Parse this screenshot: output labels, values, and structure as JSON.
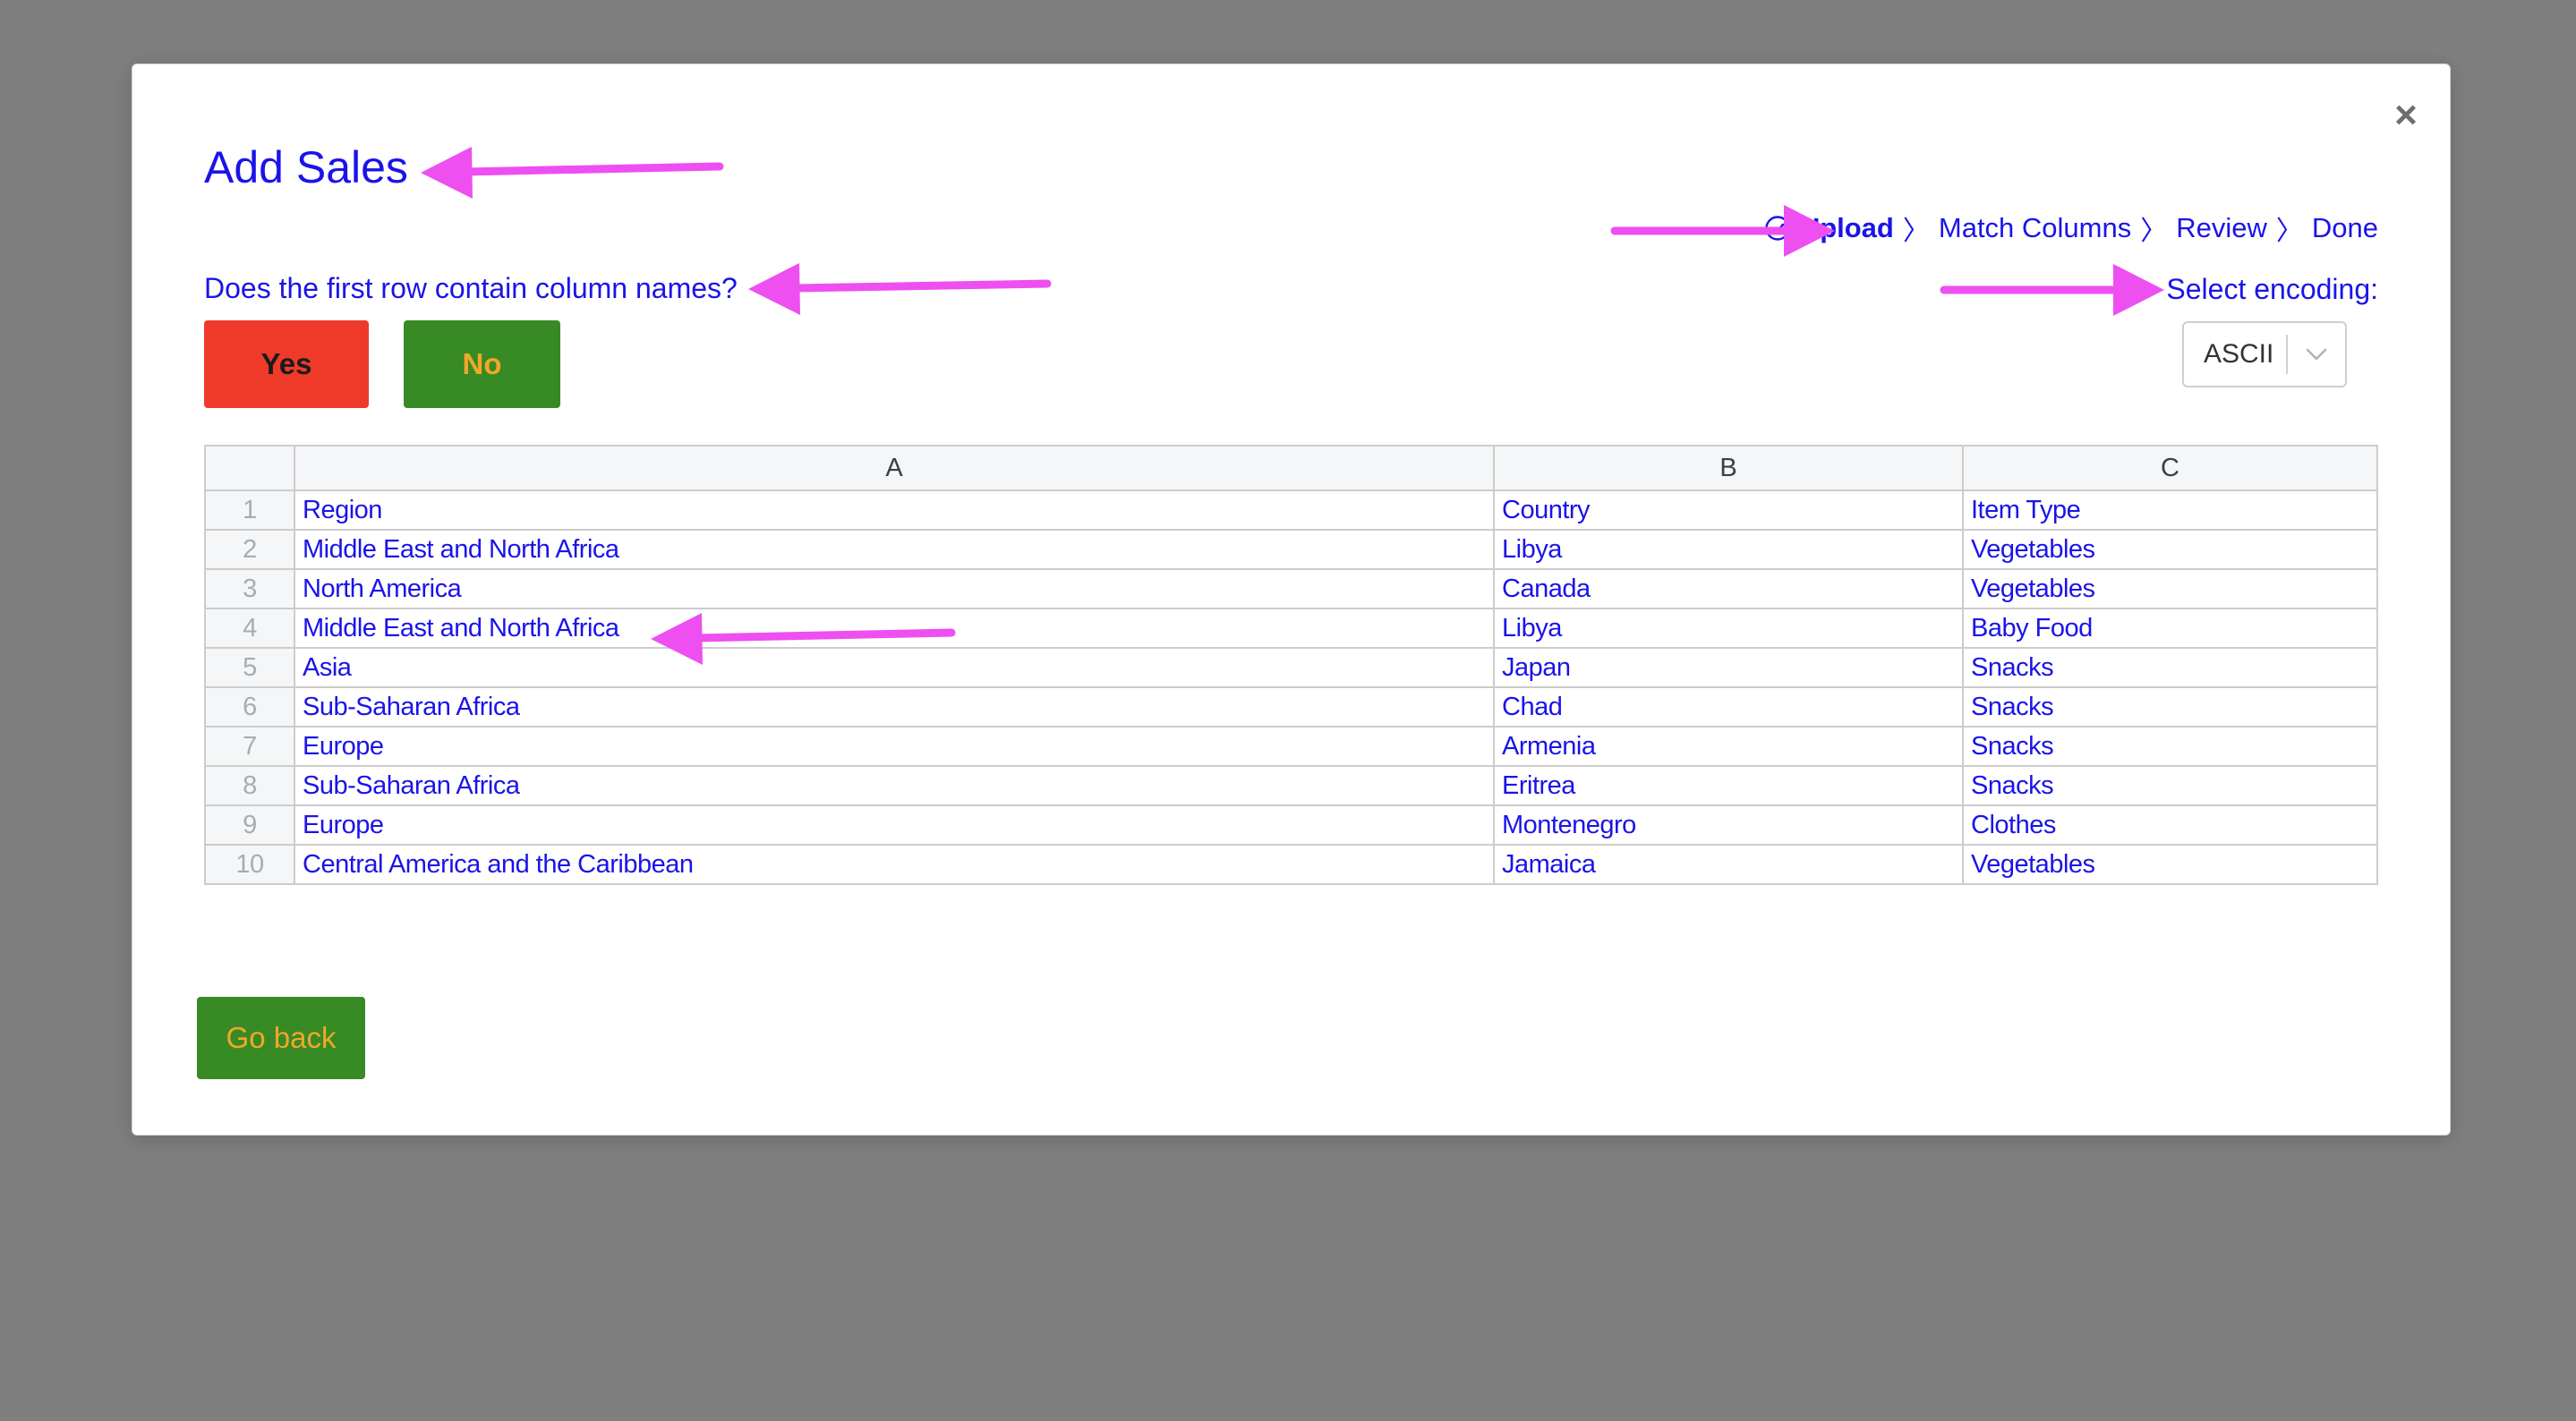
{
  "dialog": {
    "title": "Add Sales",
    "close_label": "×",
    "question": "Does the first row contain column names?",
    "yes_label": "Yes",
    "no_label": "No",
    "back_label": "Go back"
  },
  "steps": {
    "items": [
      "Upload",
      "Match Columns",
      "Review",
      "Done"
    ],
    "active": "Upload",
    "separator": "〉",
    "active_icon": "check-circle-icon"
  },
  "encoding": {
    "label": "Select encoding:",
    "value": "ASCII",
    "icon": "chevron-down-icon"
  },
  "table": {
    "columns": [
      "A",
      "B",
      "C"
    ],
    "rows": [
      {
        "n": "1",
        "a": "Region",
        "b": "Country",
        "c": "Item Type"
      },
      {
        "n": "2",
        "a": "Middle East and North Africa",
        "b": "Libya",
        "c": "Vegetables"
      },
      {
        "n": "3",
        "a": "North America",
        "b": "Canada",
        "c": "Vegetables"
      },
      {
        "n": "4",
        "a": "Middle East and North Africa",
        "b": "Libya",
        "c": "Baby Food"
      },
      {
        "n": "5",
        "a": "Asia",
        "b": "Japan",
        "c": "Snacks"
      },
      {
        "n": "6",
        "a": "Sub-Saharan Africa",
        "b": "Chad",
        "c": "Snacks"
      },
      {
        "n": "7",
        "a": "Europe",
        "b": "Armenia",
        "c": "Snacks"
      },
      {
        "n": "8",
        "a": "Sub-Saharan Africa",
        "b": "Eritrea",
        "c": "Snacks"
      },
      {
        "n": "9",
        "a": "Europe",
        "b": "Montenegro",
        "c": "Clothes"
      },
      {
        "n": "10",
        "a": "Central America and the Caribbean",
        "b": "Jamaica",
        "c": "Vegetables"
      }
    ]
  },
  "colors": {
    "overlay": "#7f7f7f",
    "text_accent": "#1a14e8",
    "yes_button": "#ef3a2a",
    "no_button": "#388a24",
    "button_text": "#f1a72a",
    "annotation_arrow": "#ee4ff0"
  }
}
